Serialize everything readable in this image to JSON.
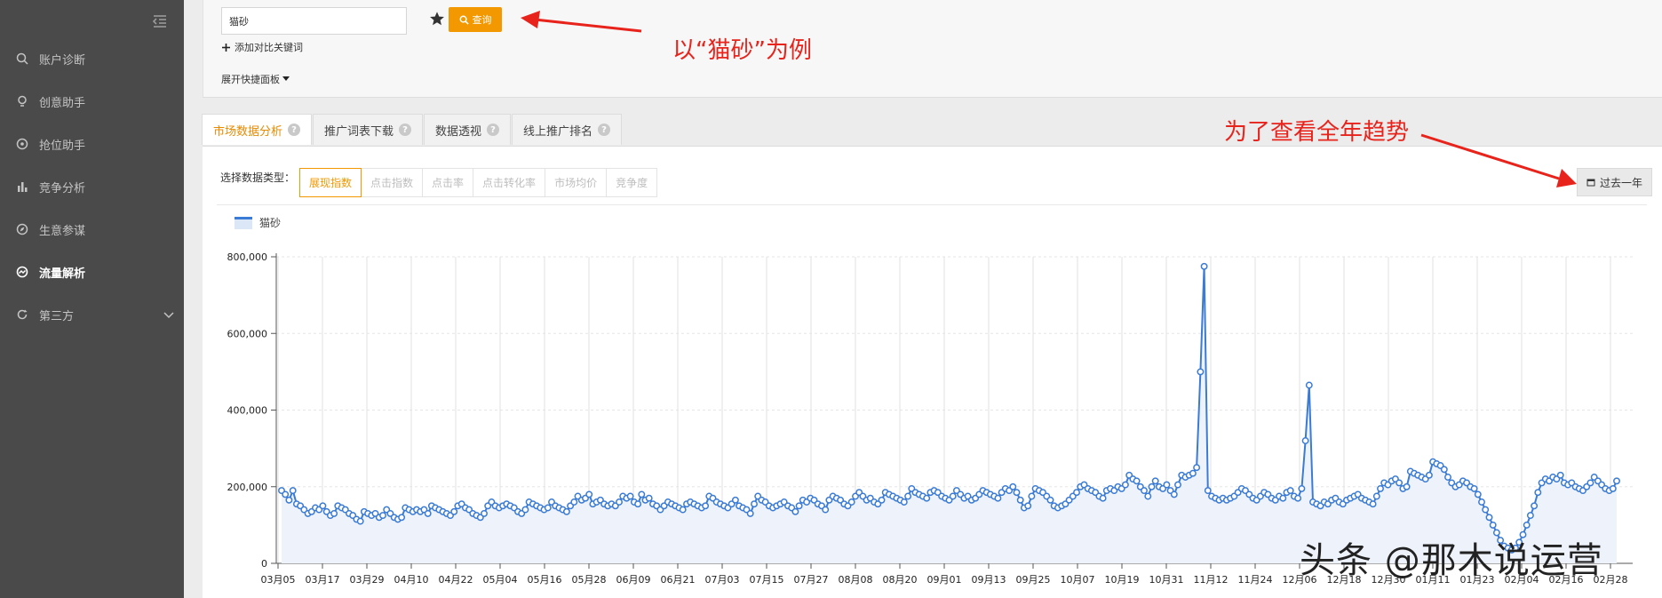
{
  "sidebar": {
    "items": [
      {
        "label": "账户诊断",
        "icon": "diagnosis-icon"
      },
      {
        "label": "创意助手",
        "icon": "lightbulb-icon"
      },
      {
        "label": "抢位助手",
        "icon": "target-icon"
      },
      {
        "label": "竞争分析",
        "icon": "bar-chart-icon"
      },
      {
        "label": "生意参谋",
        "icon": "compass-icon"
      },
      {
        "label": "流量解析",
        "icon": "traffic-icon",
        "active": true
      },
      {
        "label": "第三方",
        "icon": "refresh-icon",
        "has_submenu": true
      }
    ]
  },
  "search": {
    "value": "猫砂",
    "query_label": "查询",
    "add_compare_label": "添加对比关键词",
    "expand_panel_label": "展开快捷面板"
  },
  "annotations": {
    "example_text": "以“猫砂”为例",
    "trend_text": "为了查看全年趋势"
  },
  "tabs": [
    {
      "label": "市场数据分析",
      "active": true
    },
    {
      "label": "推广词表下载"
    },
    {
      "label": "数据透视"
    },
    {
      "label": "线上推广排名"
    }
  ],
  "data_type": {
    "label": "选择数据类型：",
    "options": [
      "展现指数",
      "点击指数",
      "点击率",
      "点击转化率",
      "市场均价",
      "竞争度"
    ],
    "selected": "展现指数"
  },
  "range_button_label": "过去一年",
  "watermark": "头条 @那木说运营",
  "colors": {
    "accent": "#f39800",
    "series": "#3a7bd5",
    "annotation": "#e8231c"
  },
  "chart_data": {
    "type": "line",
    "legend": [
      "猫砂"
    ],
    "ylim": [
      0,
      800000
    ],
    "yticks": [
      "0",
      "200,000",
      "400,000",
      "600,000",
      "800,000"
    ],
    "ytick_values": [
      0,
      200000,
      400000,
      600000,
      800000
    ],
    "x_tick_labels": [
      "03月05",
      "03月17",
      "03月29",
      "04月10",
      "04月22",
      "05月04",
      "05月16",
      "05月28",
      "06月09",
      "06月21",
      "07月03",
      "07月15",
      "07月27",
      "08月08",
      "08月20",
      "09月01",
      "09月13",
      "09月25",
      "10月07",
      "10月19",
      "10月31",
      "11月12",
      "11月24",
      "12月06",
      "12月18",
      "12月30",
      "01月11",
      "01月23",
      "02月04",
      "02月16",
      "02月28"
    ],
    "series": [
      {
        "name": "猫砂",
        "values": [
          190000,
          180000,
          165000,
          190000,
          155000,
          150000,
          140000,
          130000,
          135000,
          145000,
          140000,
          150000,
          135000,
          125000,
          130000,
          150000,
          145000,
          140000,
          130000,
          125000,
          115000,
          110000,
          135000,
          130000,
          125000,
          130000,
          120000,
          125000,
          140000,
          130000,
          120000,
          115000,
          120000,
          145000,
          140000,
          135000,
          140000,
          135000,
          140000,
          130000,
          150000,
          145000,
          140000,
          135000,
          130000,
          125000,
          135000,
          150000,
          155000,
          145000,
          140000,
          130000,
          125000,
          120000,
          130000,
          150000,
          160000,
          150000,
          145000,
          150000,
          155000,
          150000,
          145000,
          135000,
          130000,
          140000,
          160000,
          155000,
          150000,
          145000,
          140000,
          145000,
          160000,
          150000,
          145000,
          140000,
          135000,
          150000,
          160000,
          175000,
          165000,
          170000,
          180000,
          155000,
          160000,
          165000,
          155000,
          150000,
          155000,
          150000,
          160000,
          175000,
          170000,
          175000,
          160000,
          155000,
          180000,
          165000,
          170000,
          155000,
          150000,
          140000,
          150000,
          160000,
          155000,
          150000,
          145000,
          140000,
          155000,
          160000,
          155000,
          150000,
          145000,
          150000,
          175000,
          170000,
          160000,
          155000,
          150000,
          145000,
          155000,
          165000,
          150000,
          145000,
          140000,
          130000,
          155000,
          175000,
          165000,
          160000,
          150000,
          145000,
          150000,
          155000,
          160000,
          150000,
          145000,
          135000,
          150000,
          165000,
          160000,
          170000,
          165000,
          155000,
          150000,
          140000,
          165000,
          175000,
          170000,
          165000,
          155000,
          150000,
          160000,
          175000,
          185000,
          175000,
          165000,
          170000,
          160000,
          155000,
          165000,
          185000,
          180000,
          175000,
          170000,
          165000,
          160000,
          175000,
          195000,
          185000,
          180000,
          175000,
          170000,
          185000,
          190000,
          185000,
          175000,
          170000,
          165000,
          175000,
          190000,
          180000,
          170000,
          175000,
          165000,
          170000,
          180000,
          190000,
          185000,
          180000,
          175000,
          170000,
          185000,
          195000,
          190000,
          200000,
          185000,
          165000,
          145000,
          150000,
          175000,
          195000,
          190000,
          185000,
          175000,
          165000,
          150000,
          145000,
          150000,
          155000,
          165000,
          175000,
          185000,
          200000,
          205000,
          195000,
          190000,
          185000,
          175000,
          170000,
          190000,
          195000,
          190000,
          200000,
          195000,
          205000,
          230000,
          220000,
          215000,
          200000,
          190000,
          175000,
          200000,
          215000,
          200000,
          195000,
          205000,
          190000,
          180000,
          205000,
          230000,
          225000,
          230000,
          235000,
          250000,
          500000,
          775000,
          190000,
          175000,
          170000,
          165000,
          170000,
          165000,
          170000,
          175000,
          185000,
          195000,
          190000,
          180000,
          170000,
          165000,
          175000,
          185000,
          180000,
          170000,
          165000,
          175000,
          170000,
          185000,
          190000,
          175000,
          170000,
          195000,
          320000,
          465000,
          160000,
          155000,
          150000,
          160000,
          155000,
          165000,
          170000,
          160000,
          155000,
          165000,
          170000,
          175000,
          180000,
          170000,
          165000,
          160000,
          155000,
          175000,
          195000,
          210000,
          205000,
          215000,
          220000,
          210000,
          195000,
          200000,
          240000,
          235000,
          230000,
          225000,
          220000,
          230000,
          265000,
          260000,
          255000,
          245000,
          225000,
          210000,
          200000,
          205000,
          215000,
          210000,
          200000,
          195000,
          180000,
          160000,
          140000,
          120000,
          100000,
          80000,
          60000,
          45000,
          40000,
          35000,
          40000,
          55000,
          75000,
          100000,
          125000,
          150000,
          185000,
          210000,
          220000,
          215000,
          225000,
          220000,
          230000,
          210000,
          205000,
          210000,
          200000,
          195000,
          190000,
          200000,
          210000,
          225000,
          215000,
          205000,
          195000,
          190000,
          195000,
          215000
        ]
      }
    ]
  }
}
